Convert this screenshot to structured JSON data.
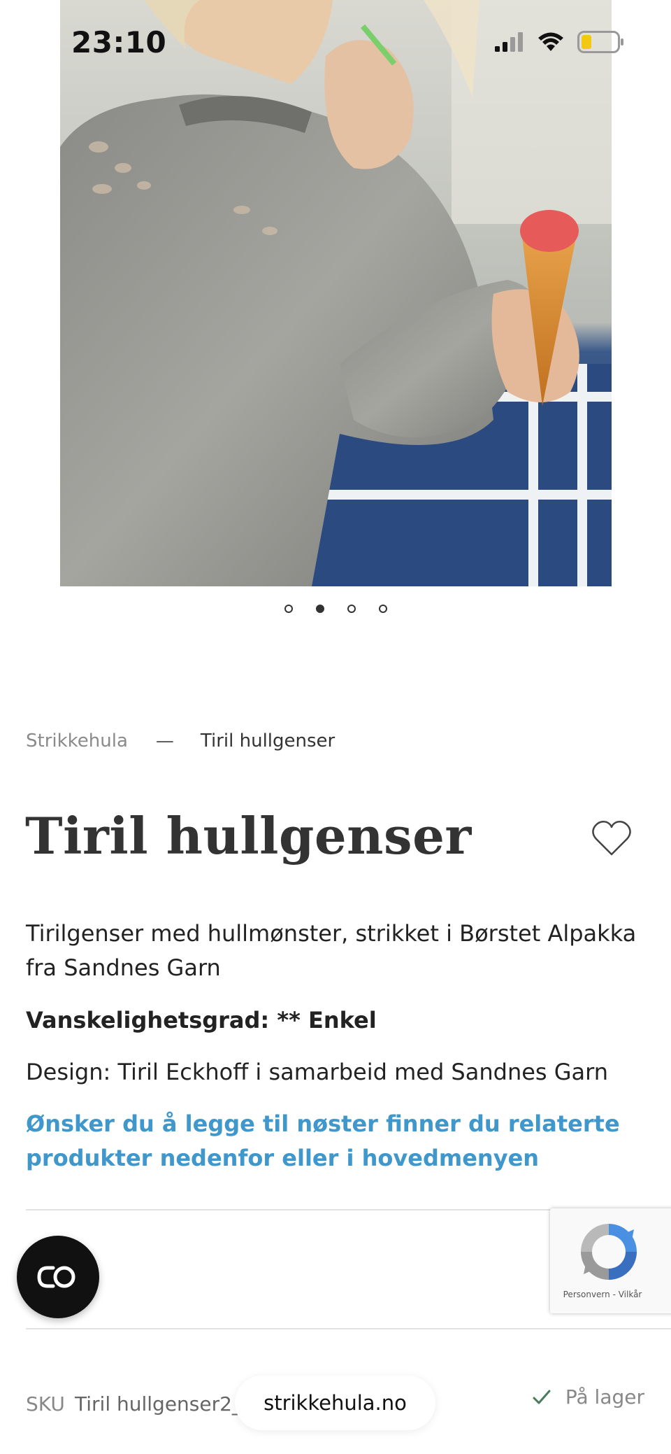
{
  "status_bar": {
    "time": "23:10"
  },
  "product_image": {
    "alt_hint": "photo"
  },
  "carousel": {
    "dot_count": 4,
    "active_index": 1
  },
  "breadcrumb": {
    "home": "Strikkehula",
    "separator": "—",
    "current": "Tiril hullgenser"
  },
  "product": {
    "title": "Tiril hullgenser",
    "description": "Tirilgenser med hullmønster, strikket i Børstet Alpakka fra Sandnes Garn",
    "difficulty": "Vanskelighetsgrad: ** Enkel",
    "design": "Design: Tiril Eckhoff i samarbeid med Sandnes Garn",
    "yarn_note": "Ønsker du å legge til nøster finner du relaterte produkter nedenfor eller i hovedmenyen",
    "sku_label": "SKU",
    "sku_value": "Tiril hullgenser2_",
    "stock": "På lager"
  },
  "recaptcha": {
    "links": "Personvern - Vilkår"
  },
  "browser": {
    "url": "strikkehula.no"
  },
  "colors": {
    "accent_link": "#3f97cc",
    "stock_check": "#4a7a5e"
  }
}
